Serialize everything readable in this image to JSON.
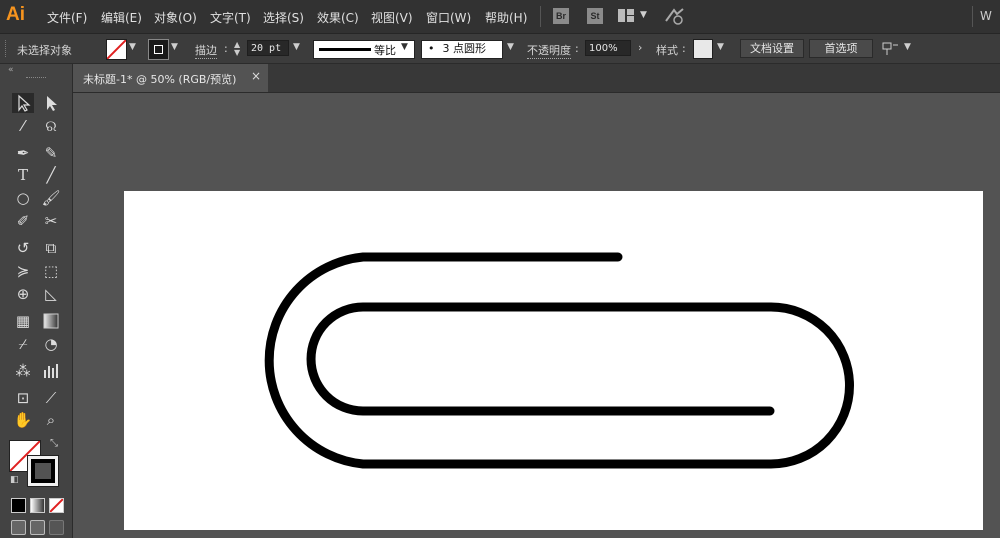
{
  "app": {
    "logo": "Ai"
  },
  "menu": [
    "文件(F)",
    "编辑(E)",
    "对象(O)",
    "文字(T)",
    "选择(S)",
    "效果(C)",
    "视图(V)",
    "窗口(W)",
    "帮助(H)"
  ],
  "top_icons": {
    "bridge": "Br",
    "stock": "St",
    "workspace": "W"
  },
  "control_bar": {
    "selection_status": "未选择对象",
    "stroke_label": "描边",
    "stroke_weight": "20 pt",
    "stroke_profile": "等比",
    "brush_label": "3 点圆形",
    "brush_dot": "•",
    "opacity_label": "不透明度",
    "opacity_value": "100%",
    "style_label": "样式",
    "doc_setup": "文档设置",
    "preferences": "首选项"
  },
  "document": {
    "tab_title": "未标题-1* @ 50% (RGB/预览)",
    "close": "×"
  },
  "colors": {
    "accent": "#f7941e",
    "canvas": "#535353",
    "artboard": "#ffffff",
    "artwork_stroke": "#000000"
  },
  "tools": [
    "selection-tool",
    "direct-selection-tool",
    "magic-wand-tool",
    "lasso-tool",
    "pen-tool",
    "curvature-tool",
    "type-tool",
    "line-segment-tool",
    "ellipse-tool",
    "paintbrush-tool",
    "shaper-tool",
    "scissors-tool",
    "rotate-tool",
    "scale-tool",
    "width-tool",
    "free-transform-tool",
    "shape-builder-tool",
    "perspective-grid-tool",
    "mesh-tool",
    "gradient-tool",
    "eyedropper-tool",
    "blend-tool",
    "symbol-sprayer-tool",
    "column-graph-tool",
    "artboard-tool",
    "slice-tool",
    "hand-tool",
    "zoom-tool"
  ]
}
